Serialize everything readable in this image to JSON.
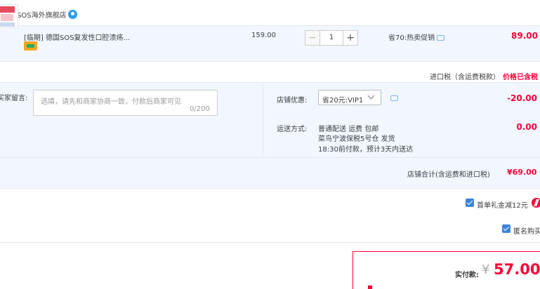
{
  "shop": {
    "label": "店铺：SOS海外旗舰店",
    "icon": "wangwang-chat-icon"
  },
  "item": {
    "title": "[临期] 德国SOS复发性口腔溃疡...",
    "unit_price": "159.00",
    "quantity": "1",
    "promotion": "省70:热卖促销",
    "total": "89.00",
    "qty_minus": "−",
    "qty_plus": "+"
  },
  "tax": {
    "label": "进口税（含运费税款）",
    "value": "价格已含税"
  },
  "message": {
    "label": "买家留言:",
    "placeholder": "选填，请先和商家协商一致，付款后商家可见",
    "count": "0/200"
  },
  "discount": {
    "label": "店铺优惠:",
    "selected": "省20元:VIP1",
    "amount": "-20.00"
  },
  "shipping": {
    "label": "运送方式:",
    "line1": "普通配送 运费 包邮",
    "line2": "菜鸟宁波保税5号仓   发货",
    "line3": "18:30前付款，预计3天内送达",
    "amount": "0.00"
  },
  "store_total": {
    "label": "店铺合计(含运费和进口税)",
    "value": "¥69.00"
  },
  "options": {
    "gift_deduct": "首单礼金减12元",
    "anonymous": "匿名购买"
  },
  "payment": {
    "label": "实付款:",
    "currency": "¥",
    "amount": "57.00"
  },
  "colors": {
    "accent_red": "#ff0036",
    "row_bg": "#f2f7ff",
    "checkbox_blue": "#3d82dc"
  }
}
